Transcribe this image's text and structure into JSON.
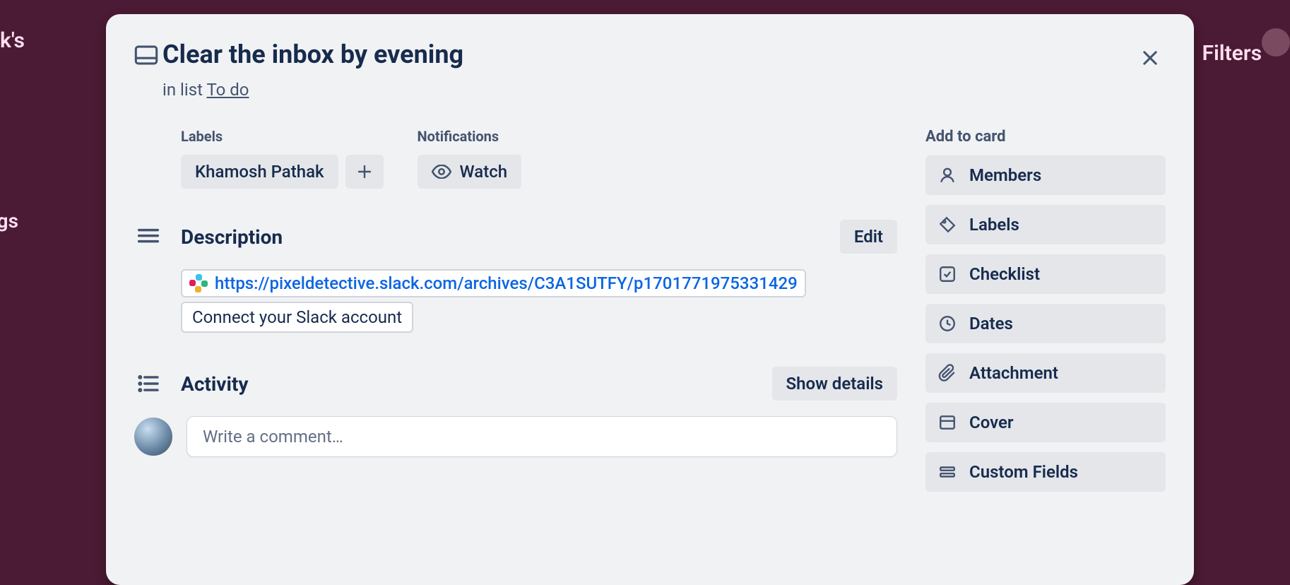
{
  "background": {
    "top_left_text": "k's",
    "top_right_text": "Filters",
    "left_mid_text": "ngs"
  },
  "card": {
    "title": "Clear the inbox by evening",
    "list_prefix": "in list ",
    "list_name": "To do"
  },
  "labels": {
    "heading": "Labels",
    "items": [
      "Khamosh Pathak"
    ]
  },
  "notifications": {
    "heading": "Notifications",
    "watch_label": "Watch"
  },
  "description": {
    "heading": "Description",
    "edit_label": "Edit",
    "link_text": "https://pixeldetective.slack.com/archives/C3A1SUTFY/p1701771975331429",
    "connect_label": "Connect your Slack account"
  },
  "activity": {
    "heading": "Activity",
    "show_details": "Show details",
    "comment_placeholder": "Write a comment…"
  },
  "sidebar": {
    "heading": "Add to card",
    "items": [
      {
        "label": "Members"
      },
      {
        "label": "Labels"
      },
      {
        "label": "Checklist"
      },
      {
        "label": "Dates"
      },
      {
        "label": "Attachment"
      },
      {
        "label": "Cover"
      },
      {
        "label": "Custom Fields"
      }
    ]
  }
}
